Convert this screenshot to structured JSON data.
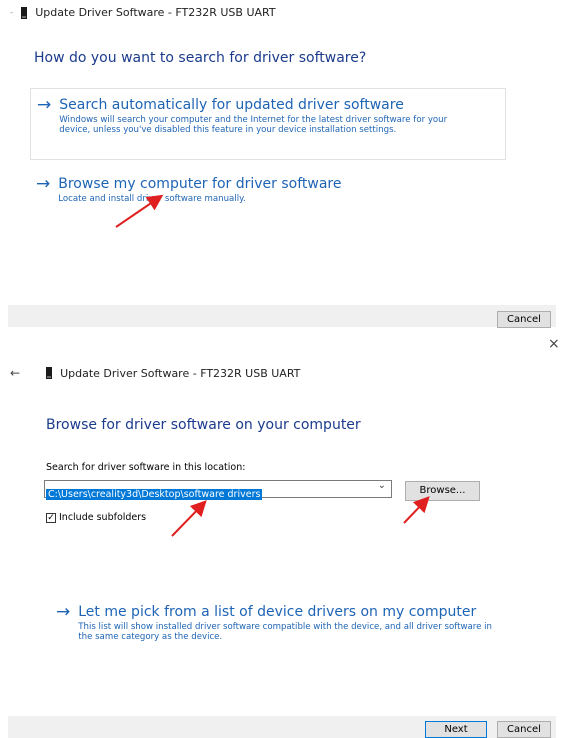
{
  "dialog1": {
    "title": "Update Driver Software - FT232R USB UART",
    "heading": "How do you want to search for driver software?",
    "option_auto": {
      "title": "Search automatically for updated driver software",
      "description": "Windows will search your computer and the Internet for the latest driver software for your device, unless you've disabled this feature in your device installation settings."
    },
    "option_browse": {
      "title": "Browse my computer for driver software",
      "description": "Locate and install driver software manually."
    },
    "cancel_label": "Cancel"
  },
  "dialog2": {
    "close_glyph": "×",
    "back_glyph": "←",
    "title": "Update Driver Software - FT232R USB UART",
    "heading": "Browse for driver software on your computer",
    "search_label": "Search for driver software in this location:",
    "path_value": "C:\\Users\\creality3d\\Desktop\\software drivers",
    "browse_label": "Browse...",
    "include_subfolders_label": "Include subfolders",
    "include_subfolders_checked": true,
    "check_glyph": "✓",
    "option_pick": {
      "title": "Let me pick from a list of device drivers on my computer",
      "description": "This list will show installed driver software compatible with the device, and all driver software in the same category as the device."
    },
    "next_label": "Next",
    "cancel_label": "Cancel"
  },
  "glyphs": {
    "arrow": "→",
    "dropdown": "⌄"
  },
  "colors": {
    "link_blue": "#1e64b4",
    "heading_blue": "#1c3b8d",
    "annotation_red": "#e02020",
    "selection_blue": "#0078d7"
  }
}
